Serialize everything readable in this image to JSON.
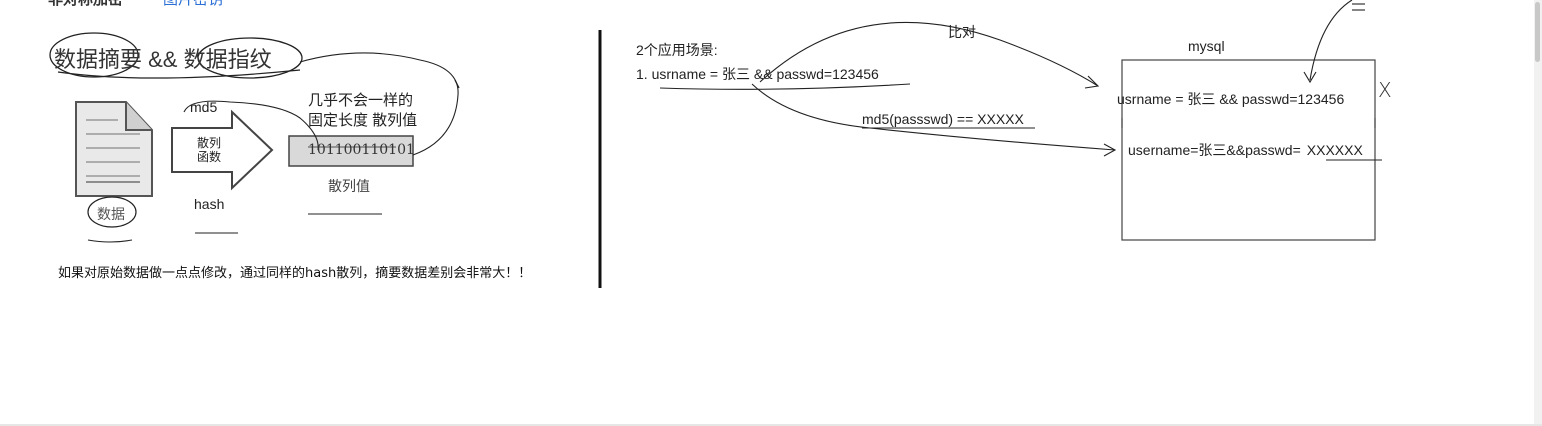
{
  "header": {
    "cut_left": "非对称加密",
    "cut_link": "图片密钥"
  },
  "left": {
    "title": "数据摘要 && 数据指纹",
    "md5_label": "md5",
    "arrow_text_line1": "散列",
    "arrow_text_line2": "函数",
    "hash_label": "hash",
    "data_label": "数据",
    "note_line1": "几乎不会一样的",
    "note_line2": "固定长度 散列值",
    "hash_value": "101100110101",
    "hash_caption": "散列值",
    "footer_note": "如果对原始数据做一点点修改，通过同样的hash散列，摘要数据差别会非常大！！"
  },
  "right": {
    "scenarios_title": "2个应用场景:",
    "scenario_1": "1. usrname = 张三 && passwd=123456",
    "compare_label": "比对",
    "md5_expr": "md5(passswd) == XXXXX",
    "db_label": "mysql",
    "db_row_1": "usrname = 张三 && passwd=123456",
    "db_row_2_prefix": "username=张三&&passwd=",
    "db_row_2_value": "XXXXXX",
    "x_mark": "X"
  },
  "colors": {
    "ink": "#222222",
    "link": "#2b6fd6",
    "doc_fill": "#e9e9e9",
    "hash_box_fill": "#d9d9d9"
  }
}
